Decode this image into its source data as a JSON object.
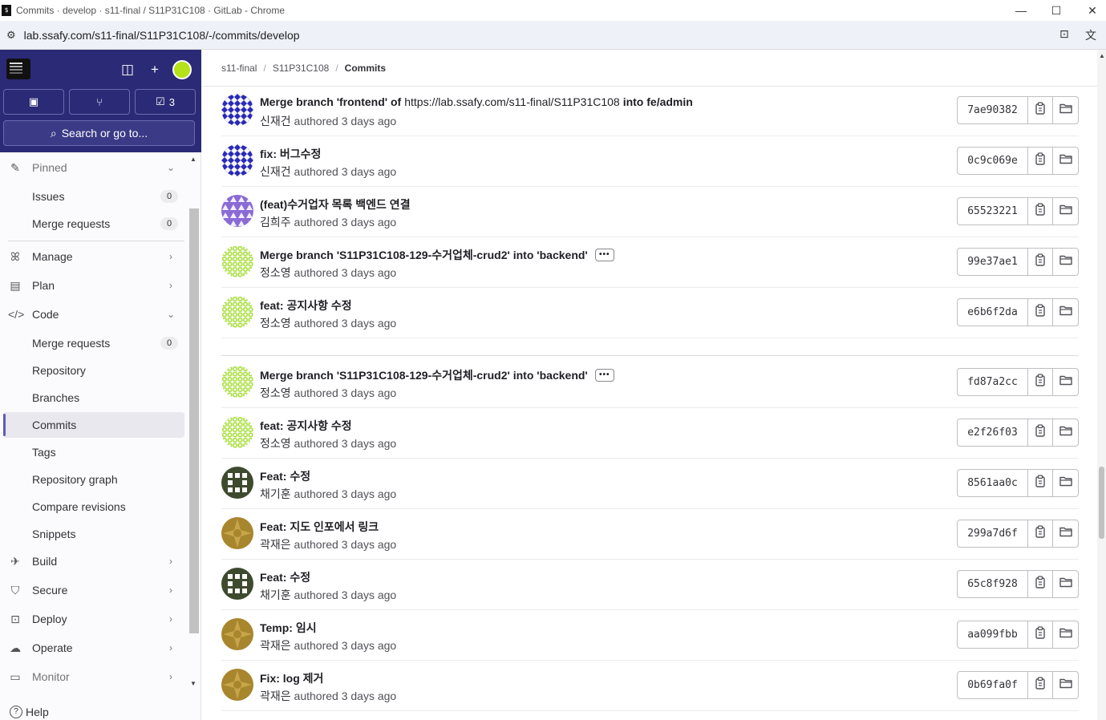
{
  "window": {
    "title": "Commits · develop · s11-final / S11P31C108 · GitLab - Chrome",
    "url": "lab.ssafy.com/s11-final/S11P31C108/-/commits/develop"
  },
  "sidebar": {
    "todo_count": "3",
    "search_label": "Search or go to...",
    "items": [
      {
        "label": "Pinned",
        "type": "section"
      },
      {
        "label": "Issues",
        "count": "0"
      },
      {
        "label": "Merge requests",
        "count": "0"
      },
      {
        "label": "Manage"
      },
      {
        "label": "Plan"
      },
      {
        "label": "Code"
      },
      {
        "label": "Merge requests",
        "count": "0"
      },
      {
        "label": "Repository"
      },
      {
        "label": "Branches"
      },
      {
        "label": "Commits"
      },
      {
        "label": "Tags"
      },
      {
        "label": "Repository graph"
      },
      {
        "label": "Compare revisions"
      },
      {
        "label": "Snippets"
      },
      {
        "label": "Build"
      },
      {
        "label": "Secure"
      },
      {
        "label": "Deploy"
      },
      {
        "label": "Operate"
      },
      {
        "label": "Monitor"
      }
    ],
    "help_label": "Help"
  },
  "breadcrumb": {
    "group": "s11-final",
    "project": "S11P31C108",
    "current": "Commits"
  },
  "commits": [
    {
      "title": "Merge branch 'frontend' of",
      "link": "https://lab.ssafy.com/s11-final/S11P31C108",
      "title_suffix": "into fe/admin",
      "author": "신재건",
      "time": "authored 3 days ago",
      "sha": "7ae90382",
      "avatar_color": "#2a2ab8",
      "avatar_style": "grid"
    },
    {
      "title": "fix: 버그수정",
      "author": "신재건",
      "time": "authored 3 days ago",
      "sha": "0c9c069e",
      "avatar_color": "#2a2ab8",
      "avatar_style": "grid"
    },
    {
      "title": "(feat)수거업자 목록 백엔드 연결",
      "author": "김희주",
      "time": "authored 3 days ago",
      "sha": "65523221",
      "avatar_color": "#8a6bd6",
      "avatar_style": "tri"
    },
    {
      "title": "Merge branch 'S11P31C108-129-수거업체-crud2' into 'backend'",
      "has_more": true,
      "more_label": "•••",
      "author": "정소영",
      "time": "authored 3 days ago",
      "sha": "99e37ae1",
      "avatar_color": "#a6e22e",
      "avatar_style": "dots"
    },
    {
      "title": "feat: 공지사항 수정",
      "author": "정소영",
      "time": "authored 3 days ago",
      "sha": "e6b6f2da",
      "avatar_color": "#a6e22e",
      "avatar_style": "dots"
    },
    {
      "title": "Merge branch 'S11P31C108-129-수거업체-crud2' into 'backend'",
      "has_more": true,
      "more_label": "•••",
      "author": "정소영",
      "time": "authored 3 days ago",
      "sha": "fd87a2cc",
      "avatar_color": "#a6e22e",
      "avatar_style": "dots"
    },
    {
      "title": "feat: 공지사항 수정",
      "author": "정소영",
      "time": "authored 3 days ago",
      "sha": "e2f26f03",
      "avatar_color": "#a6e22e",
      "avatar_style": "dots"
    },
    {
      "title": "Feat: 수정",
      "author": "채기훈",
      "time": "authored 3 days ago",
      "sha": "8561aa0c",
      "avatar_color": "#3e4a2e",
      "avatar_style": "dice"
    },
    {
      "title": "Feat: 지도 인포에서 링크",
      "author": "곽재은",
      "time": "authored 3 days ago",
      "sha": "299a7d6f",
      "avatar_color": "#a8862e",
      "avatar_style": "star"
    },
    {
      "title": "Feat: 수정",
      "author": "채기훈",
      "time": "authored 3 days ago",
      "sha": "65c8f928",
      "avatar_color": "#3e4a2e",
      "avatar_style": "dice"
    },
    {
      "title": "Temp: 임시",
      "author": "곽재은",
      "time": "authored 3 days ago",
      "sha": "aa099fbb",
      "avatar_color": "#a8862e",
      "avatar_style": "star"
    },
    {
      "title": "Fix: log 제거",
      "author": "곽재은",
      "time": "authored 3 days ago",
      "sha": "0b69fa0f",
      "avatar_color": "#a8862e",
      "avatar_style": "star"
    }
  ]
}
